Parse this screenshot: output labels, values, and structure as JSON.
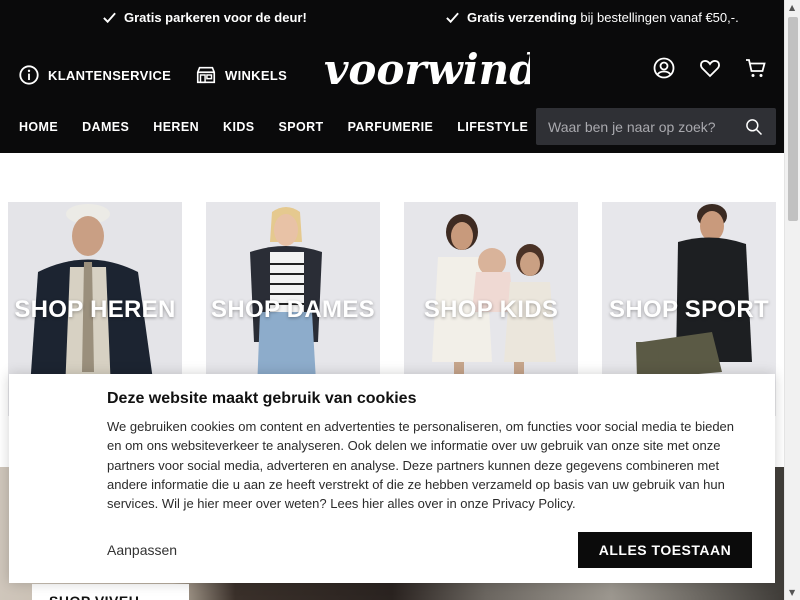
{
  "usp_bar": {
    "parking": {
      "bold": "Gratis parkeren voor de deur!"
    },
    "shipping": {
      "bold": "Gratis verzending",
      "rest": " bij bestellingen vanaf €50,-."
    }
  },
  "utility": {
    "service_label": "KLANTENSERVICE",
    "stores_label": "WINKELS"
  },
  "logo_text": "voorwinden",
  "nav": {
    "items": [
      "HOME",
      "DAMES",
      "HEREN",
      "KIDS",
      "SPORT",
      "PARFUMERIE",
      "LIFESTYLE"
    ]
  },
  "search": {
    "placeholder": "Waar ben je naar op zoek?"
  },
  "tiles": [
    {
      "label": "SHOP HEREN"
    },
    {
      "label": "SHOP DAMES"
    },
    {
      "label": "SHOP KIDS"
    },
    {
      "label": "SHOP SPORT"
    }
  ],
  "lower_button": "SHOP VIVEU",
  "cookie": {
    "title": "Deze website maakt gebruik van cookies",
    "body": "We gebruiken cookies om content en advertenties te personaliseren, om functies voor social media te bieden en om ons websiteverkeer te analyseren. Ook delen we informatie over uw gebruik van onze site met onze partners voor social media, adverteren en analyse. Deze partners kunnen deze gegevens combineren met andere informatie die u aan ze heeft verstrekt of die ze hebben verzameld op basis van uw gebruik van hun services. Wil je hier meer over weten? Lees hier alles over in onze Privacy Policy.",
    "adjust_label": "Aanpassen",
    "accept_label": "ALLES TOESTAAN"
  },
  "icons": {
    "check": "check-icon",
    "info": "info-icon",
    "store": "store-icon",
    "account": "account-icon",
    "wishlist": "heart-icon",
    "cart": "cart-icon",
    "search": "search-icon"
  },
  "colors": {
    "header_bg": "#0a0a0b",
    "search_bg": "#2f3035",
    "accent_button": "#0b0b0b",
    "tile_bg": "#e6e6ea"
  }
}
